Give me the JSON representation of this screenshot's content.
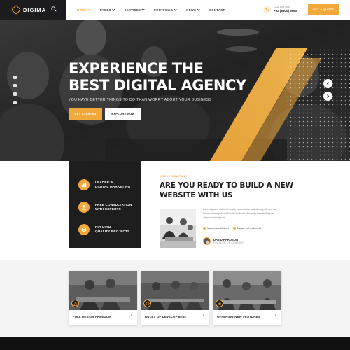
{
  "brand": {
    "name": "DIGIMA",
    "accent": "#f2a93b",
    "dark": "#1e1e1e"
  },
  "header": {
    "search_icon": "search-icon",
    "nav": [
      {
        "label": "HOME",
        "active": true,
        "dropdown": true
      },
      {
        "label": "PAGES",
        "active": false,
        "dropdown": true
      },
      {
        "label": "SERVICES",
        "active": false,
        "dropdown": true
      },
      {
        "label": "PORTFOLIO",
        "active": false,
        "dropdown": true
      },
      {
        "label": "NEWS",
        "active": false,
        "dropdown": true
      },
      {
        "label": "CONTACT",
        "active": false,
        "dropdown": false
      }
    ],
    "call_label": "CALL ANYTIME",
    "call_number": "+92 (8800) 6890",
    "quote_button": "GET A QUOTE"
  },
  "hero": {
    "title_line1": "EXPERIENCE THE",
    "title_line2": "BEST DIGITAL AGENCY",
    "subtitle": "YOU HAVE BETTER THINGS TO DO THAN WORRY ABOUT YOUR BUSINESS",
    "primary_button": "GET STARTED",
    "secondary_button": "EXPLORE NOW",
    "social_icons": [
      "facebook-icon",
      "twitter-icon",
      "pinterest-icon",
      "instagram-icon"
    ]
  },
  "features": [
    {
      "icon": "marketing-icon",
      "line1": "LEADER IN",
      "line2": "DIGITAL MARKETING"
    },
    {
      "icon": "consultation-icon",
      "line1": "FREE CONSULTATION",
      "line2": "WITH EXPERTS"
    },
    {
      "icon": "projects-icon",
      "line1": "DID HIGH",
      "line2": "QUALITY PROJECTS"
    }
  ],
  "about": {
    "eyebrow": "ABOUT COMPANY",
    "title_line1": "ARE YOU READY TO BUILD A NEW",
    "title_line2": "WEBSITE WITH US",
    "text": "Lorem ipsum dolor sit amet, consectetur adipisicing elit sed do eiusmod tempor incididunt ut labore et simply free text ipsum aliqua lorem ipsum.",
    "checks": [
      "Maecenas id amet",
      "Nulam vel sufferd sit"
    ],
    "founder_name": "DAVID HARDSON",
    "founder_role": "FOUNDER OF COMPANY"
  },
  "services": [
    {
      "title": "FULL DESIGN FREEDOM"
    },
    {
      "title": "RULES OF DEVELOPMENT"
    },
    {
      "title": "OFFERING NEW FEATURES"
    }
  ]
}
